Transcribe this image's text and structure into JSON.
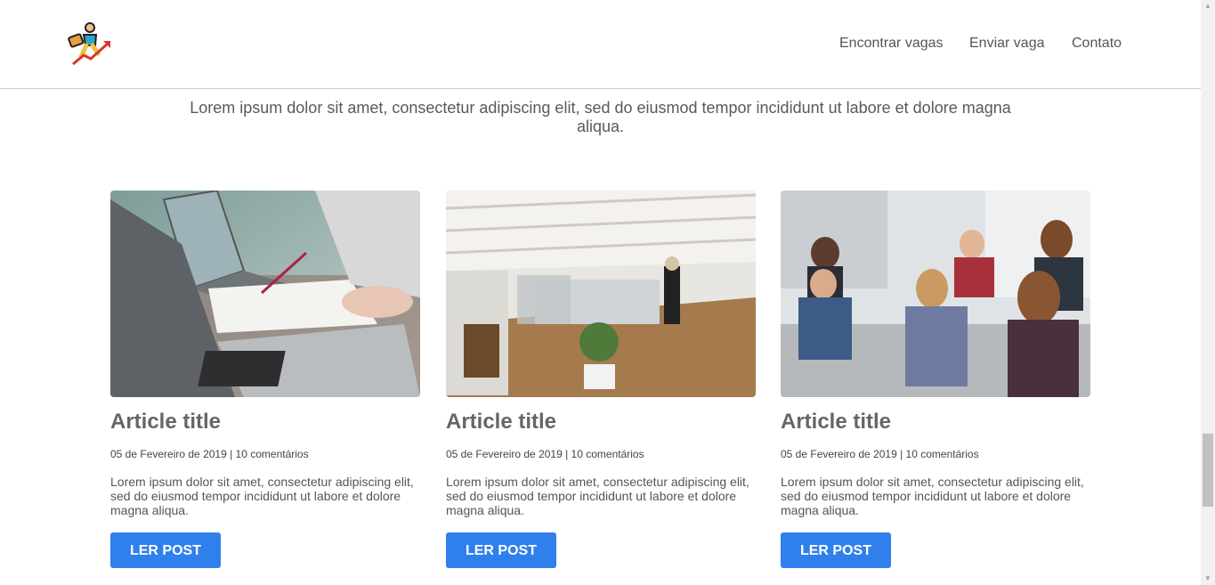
{
  "header": {
    "logo_icon": "climbing-success-icon",
    "nav": {
      "find_jobs": "Encontrar vagas",
      "send_job": "Enviar vaga",
      "contact": "Contato"
    }
  },
  "intro": "Lorem ipsum dolor sit amet, consectetur adipiscing elit, sed do eiusmod tempor incididunt ut labore et dolore magna aliqua.",
  "articles": [
    {
      "image": "laptops-meeting-photo",
      "title": "Article title",
      "meta": "05 de Fevereiro de 2019 | 10 comentários",
      "excerpt": "Lorem ipsum dolor sit amet, consectetur adipiscing elit, sed do eiusmod tempor incididunt ut labore et dolore magna aliqua.",
      "button": "LER POST"
    },
    {
      "image": "open-office-photo",
      "title": "Article title",
      "meta": "05 de Fevereiro de 2019 | 10 comentários",
      "excerpt": "Lorem ipsum dolor sit amet, consectetur adipiscing elit, sed do eiusmod tempor incididunt ut labore et dolore magna aliqua.",
      "button": "LER POST"
    },
    {
      "image": "team-discussion-photo",
      "title": "Article title",
      "meta": "05 de Fevereiro de 2019 | 10 comentários",
      "excerpt": "Lorem ipsum dolor sit amet, consectetur adipiscing elit, sed do eiusmod tempor incididunt ut labore et dolore magna aliqua.",
      "button": "LER POST"
    }
  ],
  "colors": {
    "accent": "#2f80ed",
    "text": "#555555",
    "divider": "#c8c8c8"
  }
}
